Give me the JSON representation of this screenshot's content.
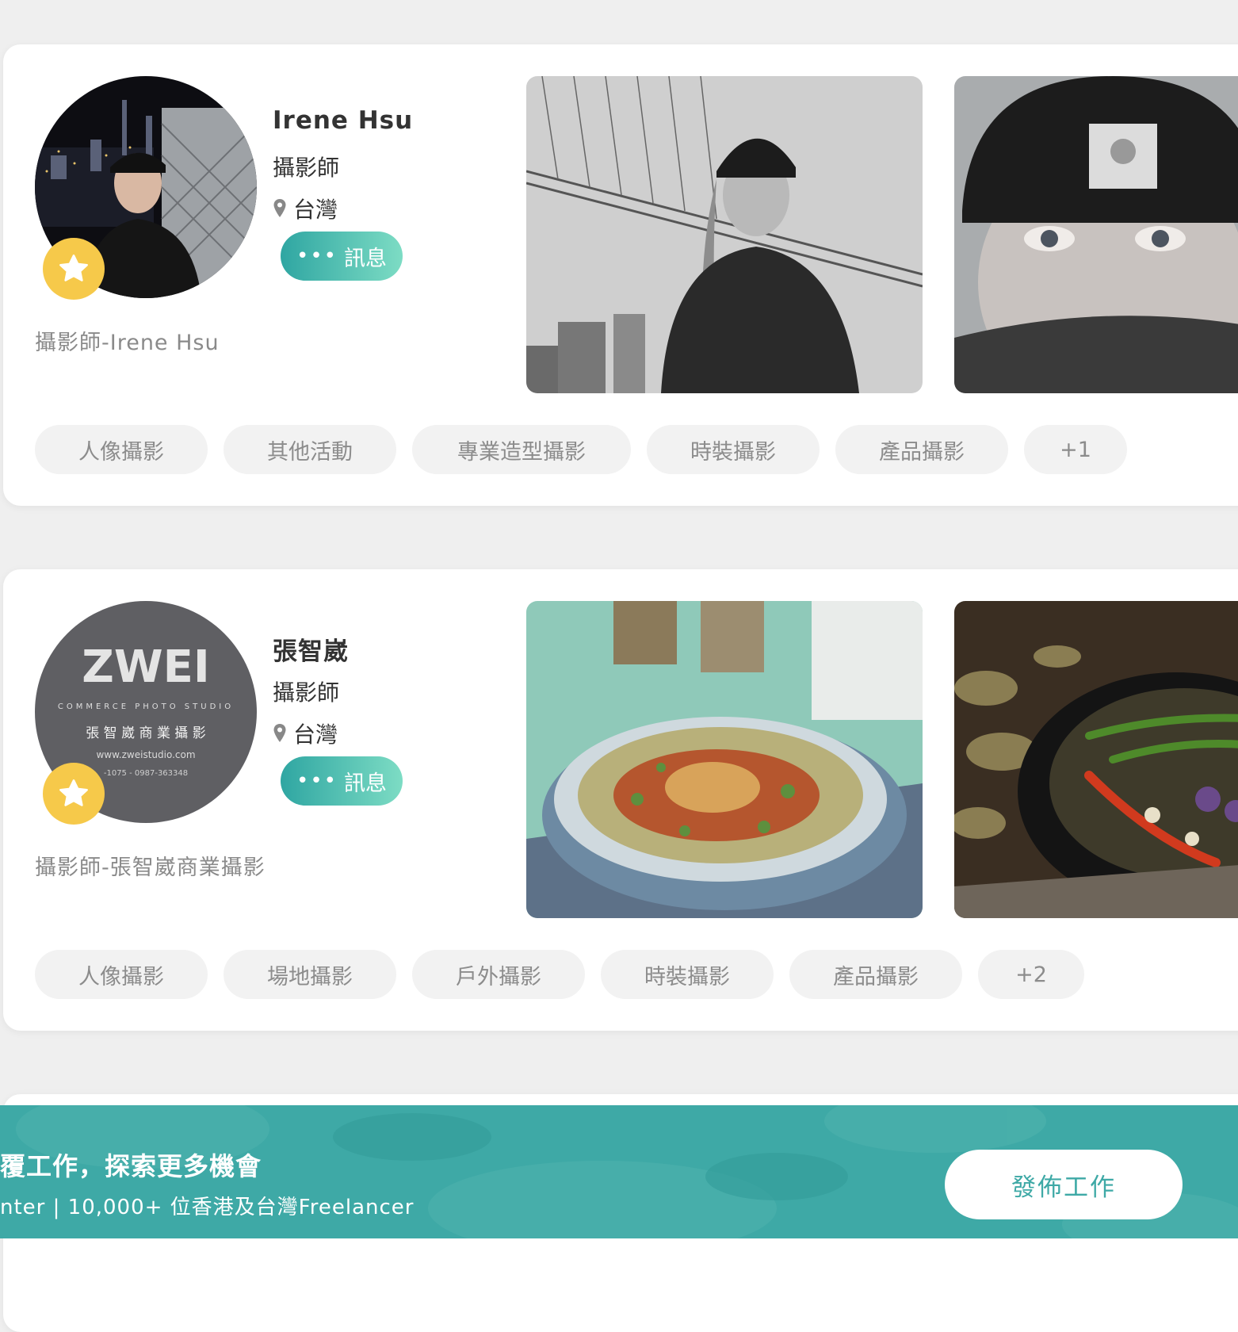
{
  "listings": [
    {
      "name": "Irene Hsu",
      "role": "攝影師",
      "location": "台灣",
      "message_label": "訊息",
      "message_dots": "•••",
      "subtitle": "攝影師-Irene Hsu",
      "tags": [
        "人像攝影",
        "其他活動",
        "專業造型攝影",
        "時裝攝影",
        "產品攝影",
        "+1"
      ]
    },
    {
      "name": "張智崴",
      "role": "攝影師",
      "location": "台灣",
      "message_label": "訊息",
      "message_dots": "•••",
      "subtitle": "攝影師-張智崴商業攝影",
      "tags": [
        "人像攝影",
        "場地攝影",
        "戶外攝影",
        "時裝攝影",
        "產品攝影",
        "+2"
      ],
      "avatar_logo": {
        "brand": "ZWEI",
        "tagline": "COMMERCE PHOTO STUDIO",
        "cn_name": "張 智 崴 商 業 攝 影",
        "site": "www.zweistudio.com",
        "phone": "-1075 - 0987-363348"
      }
    }
  ],
  "banner": {
    "title": "覆工作，探索更多機會",
    "subtitle": "nter | 10,000+ 位香港及台灣Freelancer",
    "button_label": "發佈工作"
  },
  "colors": {
    "accent": "#3ea9a6",
    "star_badge": "#f6c94a",
    "tag_bg": "#f2f2f2"
  }
}
